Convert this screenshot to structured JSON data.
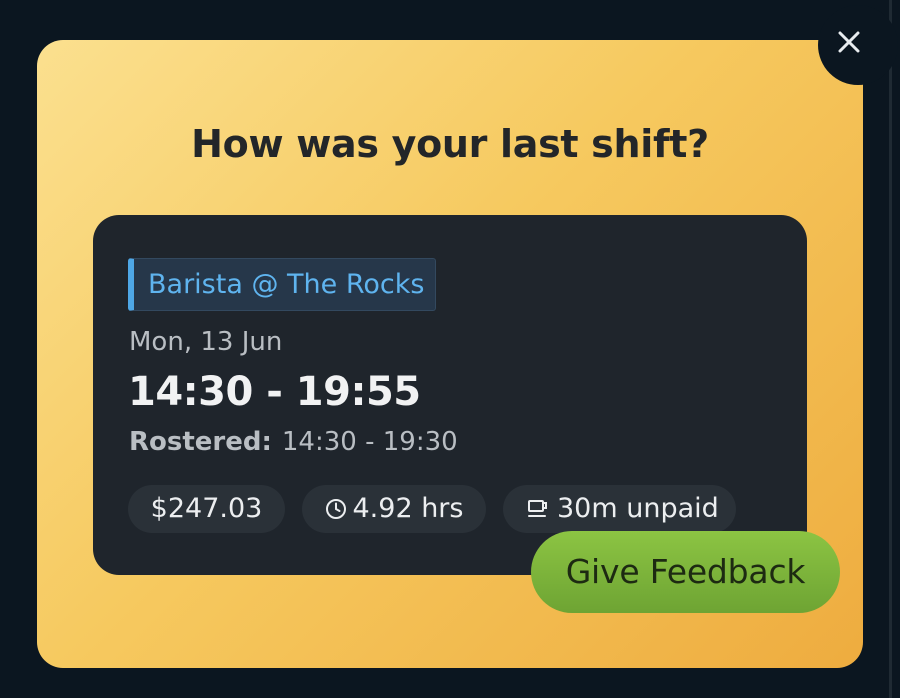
{
  "modal": {
    "title": "How was your last shift?",
    "close_icon": "close-icon"
  },
  "shift": {
    "role": "Barista @ The Rocks",
    "date": "Mon, 13 Jun",
    "time": "14:30 - 19:55",
    "rostered_label": "Rostered:",
    "rostered_time": "14:30 - 19:30",
    "pay": "$247.03",
    "hours": "4.92 hrs",
    "hours_icon": "clock-icon",
    "break": "30m unpaid",
    "break_icon": "coffee-cup-icon"
  },
  "actions": {
    "feedback_label": "Give Feedback"
  },
  "colors": {
    "background": "#0b1620",
    "modal_gradient_start": "#fbe08f",
    "modal_gradient_end": "#eeac3f",
    "card": "#1f252c",
    "role_accent": "#4ea7e6",
    "feedback_button": "#7cb43a"
  }
}
